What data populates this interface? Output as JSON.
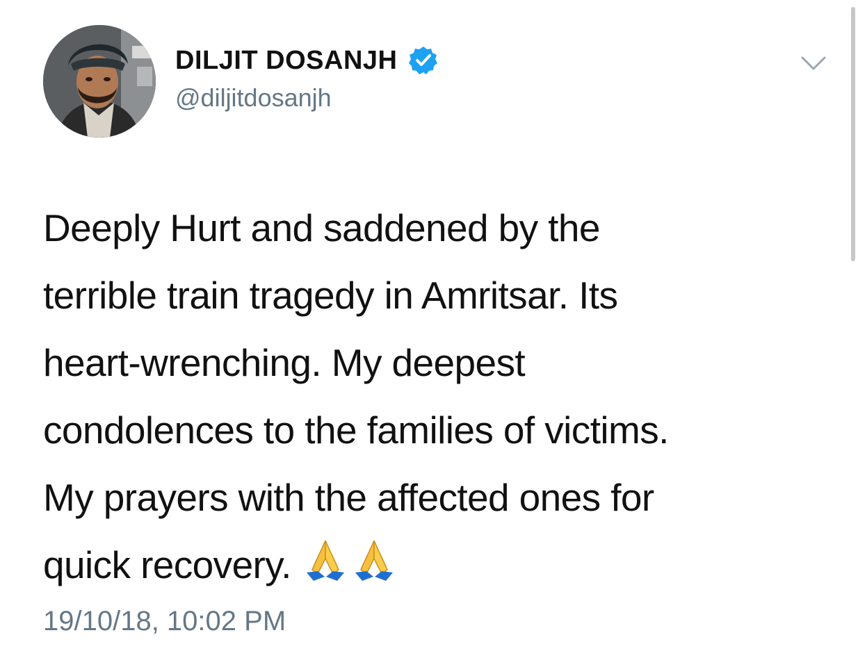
{
  "author": {
    "display_name": "DILJIT DOSANJH",
    "handle": "@diljitdosanjh",
    "verified": true
  },
  "tweet": {
    "lines": [
      "Deeply Hurt and saddened by the",
      "terrible train tragedy in Amritsar. Its",
      "heart-wrenching. My deepest",
      "condolences to the families of victims.",
      "My prayers with the affected ones for",
      "quick recovery."
    ],
    "emoji": [
      "folded-hands",
      "folded-hands"
    ],
    "timestamp": "19/10/18, 10:02 PM"
  },
  "colors": {
    "text": "#111111",
    "secondary": "#657786",
    "verified_badge": "#1da1f2",
    "background": "#ffffff"
  },
  "icons": {
    "verified": "verified-badge-icon",
    "menu": "chevron-down-icon"
  }
}
